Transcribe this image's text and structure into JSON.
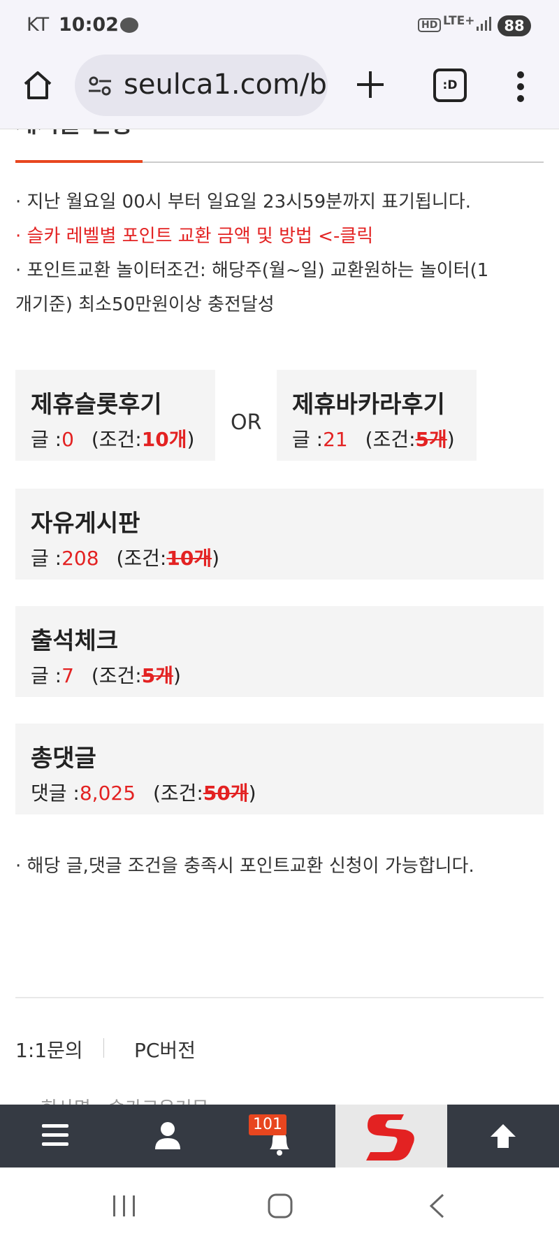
{
  "status_bar": {
    "carrier": "KT",
    "time": "10:02",
    "talk_icon": "kakaotalk-icon",
    "hd": "HD",
    "network": "LTE+",
    "battery": "88"
  },
  "browser": {
    "url": "seulca1.com/b",
    "tabs_label": ":D"
  },
  "section": {
    "title": "게시글 현황",
    "notes": [
      "· 지난 월요일 00시 부터 일요일 23시59분까지 표기됩니다.",
      "· 슬카 레벨별 포인트 교환 금액 및 방법 <-클릭",
      "· 포인트교환 놀이터조건: 해당주(월~일) 교환원하는 놀이터(1",
      "개기준) 최소50만원이상 충전달성"
    ]
  },
  "or_label": "OR",
  "cards": {
    "slot": {
      "name": "제휴슬롯후기",
      "count_label": "글 :",
      "count": "0",
      "cond_open": "(조건:",
      "cond": "10개",
      "cond_close": ")"
    },
    "baccarat": {
      "name": "제휴바카라후기",
      "count_label": "글 :",
      "count": "21",
      "cond_open": "(조건:",
      "cond": "5개",
      "cond_close": ")"
    },
    "free": {
      "name": "자유게시판",
      "count_label": "글 :",
      "count": "208",
      "cond_open": "(조건:",
      "cond": "10개",
      "cond_close": ")"
    },
    "attendance": {
      "name": "출석체크",
      "count_label": "글 :",
      "count": "7",
      "cond_open": "(조건:",
      "cond": "5개",
      "cond_close": ")"
    },
    "comments": {
      "name": "총댓글",
      "count_label": "댓글 :",
      "count": "8,025",
      "cond_open": "(조건:",
      "cond": "50개",
      "cond_close": ")"
    }
  },
  "bottom_note": "· 해당 글,댓글 조건을 충족시 포인트교환 신청이 가능합니다.",
  "footer": {
    "inquiry": "1:1문의",
    "pc": "PC버전",
    "clipped": "회사명 : 슬카코유커뮤"
  },
  "app_nav": {
    "notification_count": "101",
    "colors": {
      "bar": "#353a43",
      "accent": "#e8461f",
      "highlight": "#e32222"
    }
  }
}
